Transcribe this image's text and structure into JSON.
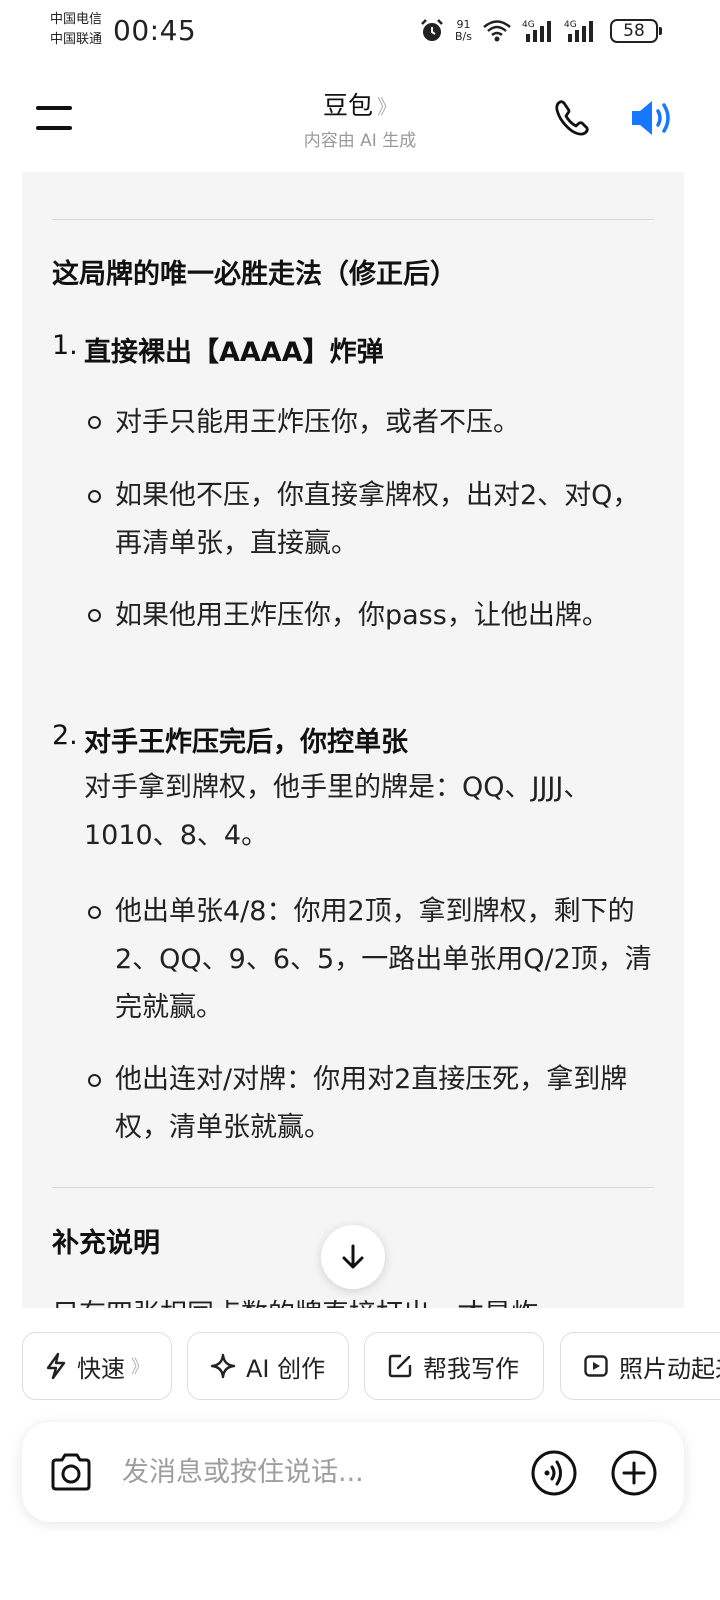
{
  "status": {
    "carrier1": "中国电信",
    "carrier2": "中国联通",
    "time": "00:45",
    "net_speed_value": "91",
    "net_speed_unit": "B/s",
    "signal1": "4G",
    "signal2": "4G",
    "battery": "58"
  },
  "header": {
    "title": "豆包",
    "title_chevron": "》",
    "subtitle": "内容由 AI 生成",
    "icons": [
      "menu-icon",
      "phone-icon",
      "speaker-icon"
    ],
    "accent_color": "#1677ff"
  },
  "content": {
    "section1_title": "这局牌的唯一必胜走法（修正后）",
    "steps": [
      {
        "number": "1.",
        "title": "直接裸出【AAAA】炸弹",
        "bullets": [
          "对手只能用王炸压你，或者不压。",
          "如果他不压，你直接拿牌权，出对2、对Q，再清单张，直接赢。",
          "如果他用王炸压你，你pass，让他出牌。"
        ]
      },
      {
        "number": "2.",
        "title": "对手王炸压完后，你控单张",
        "para": "对手拿到牌权，他手里的牌是：QQ、JJJJ、1010、8、4。",
        "bullets": [
          "他出单张4/8：你用2顶，拿到牌权，剩下的2、QQ、9、6、5，一路出单张用Q/2顶，清完就赢。",
          "他出连对/对牌：你用对2直接压死，拿到牌权，清单张就赢。"
        ]
      }
    ],
    "section2_title": "补充说明",
    "cut_text": "只有四张相同点数的牌直接打出，才是炸"
  },
  "chips": [
    {
      "label": "快速",
      "icon": "lightning-icon",
      "chevron": "》"
    },
    {
      "label": "AI 创作",
      "icon": "sparkle-icon"
    },
    {
      "label": "帮我写作",
      "icon": "edit-icon"
    },
    {
      "label": "照片动起来",
      "icon": "play-icon"
    }
  ],
  "input": {
    "placeholder": "发消息或按住说话..."
  }
}
